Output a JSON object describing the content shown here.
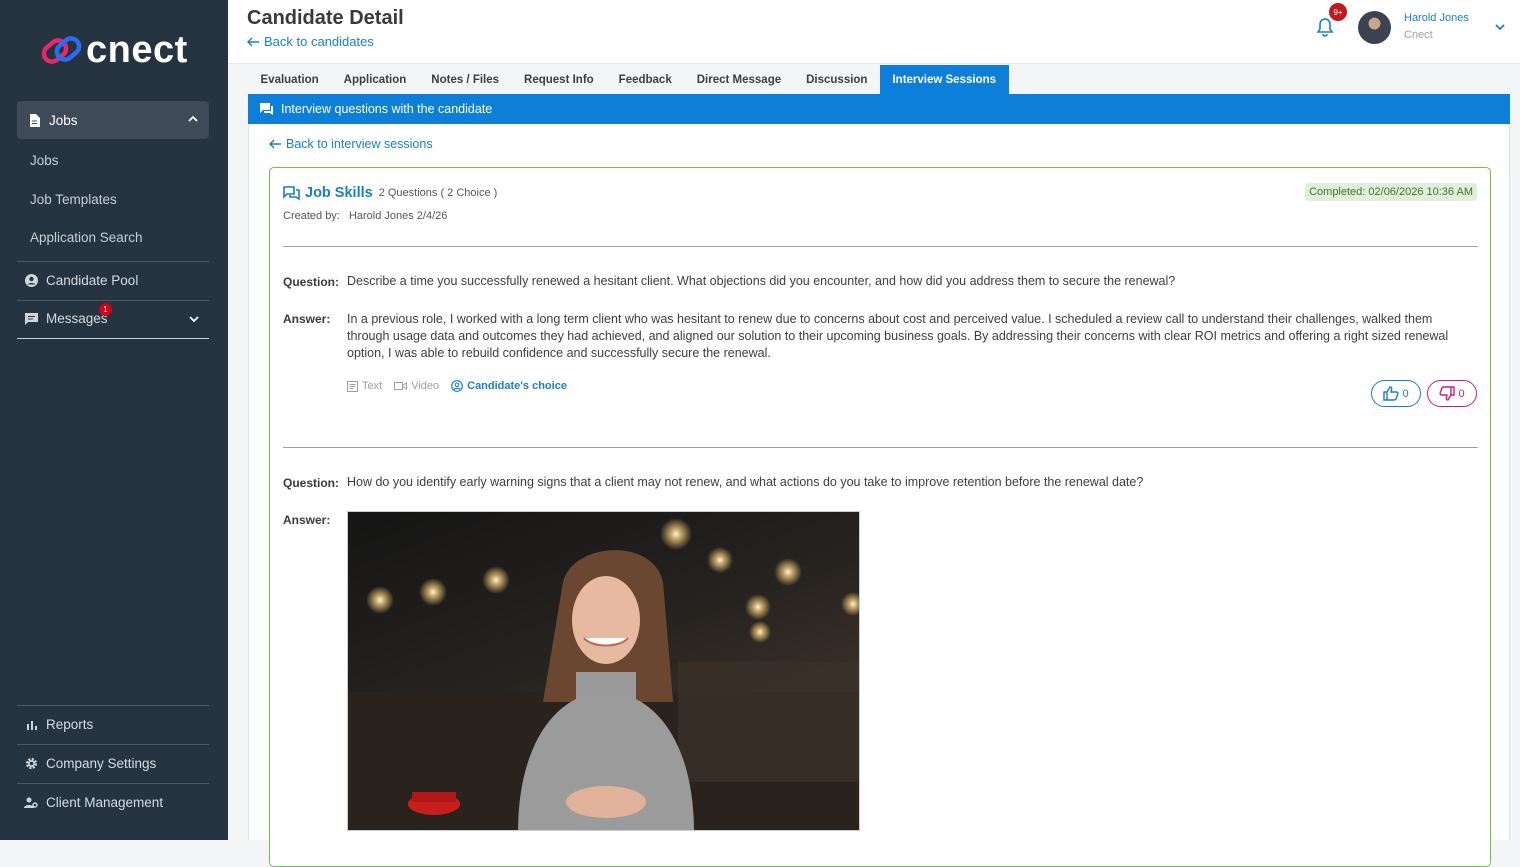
{
  "sidebar": {
    "logo_text": "cnect",
    "jobs_section": {
      "label": "Jobs",
      "sub_items": [
        "Jobs",
        "Job Templates",
        "Application Search"
      ]
    },
    "candidate_pool": "Candidate Pool",
    "messages": {
      "label": "Messages",
      "badge": "1"
    },
    "bottom": [
      "Reports",
      "Company Settings",
      "Client Management"
    ]
  },
  "header": {
    "title": "Candidate Detail",
    "back_label": "Back to candidates",
    "notif_badge": "9+",
    "user_name": "Harold Jones",
    "user_org": "Cnect"
  },
  "tabs": [
    "Evaluation",
    "Application",
    "Notes / Files",
    "Request Info",
    "Feedback",
    "Direct Message",
    "Discussion",
    "Interview Sessions"
  ],
  "active_tab": "Interview Sessions",
  "banner": "Interview questions with the candidate",
  "back_sessions": "Back to interview sessions",
  "session": {
    "title": "Job Skills",
    "count": "2 Questions ( 2 Choice )",
    "created_label": "Created by:",
    "created_value": "Harold Jones 2/4/26",
    "completed": "Completed: 02/06/2026 10:36 AM",
    "question_label": "Question:",
    "answer_label": "Answer:",
    "q1": "Describe a time you successfully renewed a hesitant client. What objections did you encounter, and how did you address them to secure the renewal?",
    "a1": "In a previous role, I worked with a long term client who was hesitant to renew due to concerns about cost and perceived value. I scheduled a review call to understand their challenges, walked them through usage data and outcomes they had achieved, and aligned our solution to their upcoming business goals. By addressing their concerns with clear ROI metrics and offering a right sized renewal option, I was able to rebuild confidence and successfully secure the renewal.",
    "mode_text": "Text",
    "mode_video": "Video",
    "mode_choice": "Candidate's choice",
    "likes": "0",
    "dislikes": "0",
    "q2": "How do you identify early warning signs that a client may not renew, and what actions do you take to improve retention before the renewal date?"
  },
  "colors": {
    "primary": "#0d7fd9",
    "sidebar": "#263442",
    "card_border": "#6cc24a"
  }
}
